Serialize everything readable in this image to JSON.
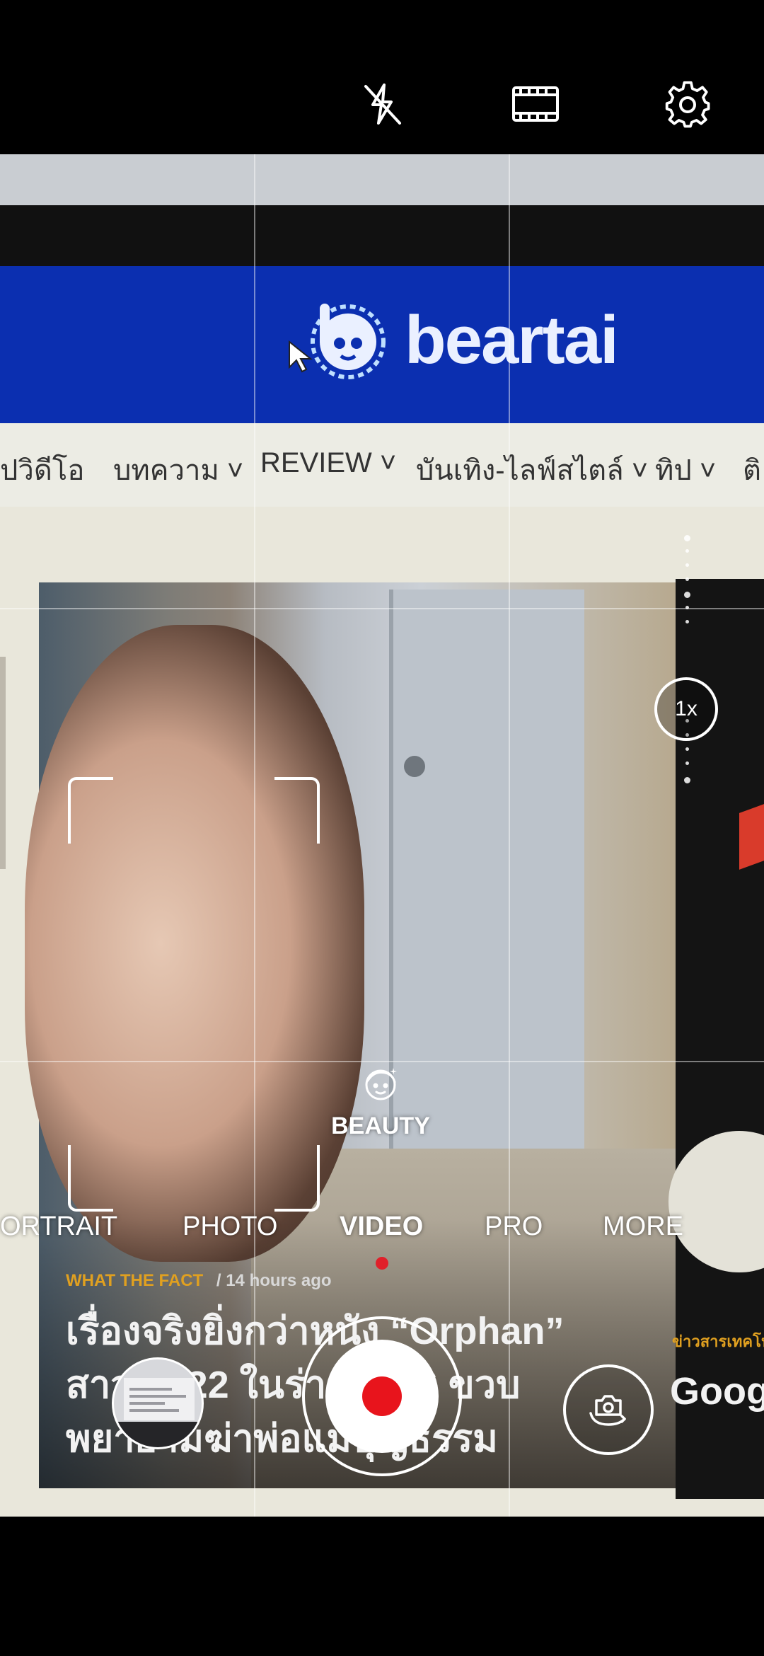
{
  "top_bar": {
    "flash_icon": "flash-off-icon",
    "ratio_icon": "aspect-ratio-icon",
    "settings_icon": "gear-icon"
  },
  "viewfinder_scene": {
    "site_logo": "beartai",
    "nav_items": [
      "ปวิดีโอ",
      "บทความ ˅",
      "REVIEW ˅",
      "บันเทิง-ไลฟ์สไตล์ ˅",
      "ทิป ˅",
      "ติ"
    ],
    "article": {
      "category": "WHAT THE FACT",
      "time": "/ 14 hours ago",
      "title": "เรื่องจริงยิ่งกว่าหนัง “Orphan” สาววัย 22 ในร่างเด็ก 6 ขวบ พยายามฆ่าพ่อแม่บุญธรรม"
    },
    "side_article": {
      "category": "ข่าวสารเทคโนโลยี",
      "title": "Googl ใช้งาน"
    }
  },
  "zoom": {
    "label": "1x"
  },
  "beauty": {
    "label": "BEAUTY",
    "icon": "beauty-face-icon"
  },
  "modes": {
    "items": [
      "ORTRAIT",
      "PHOTO",
      "VIDEO",
      "PRO",
      "MORE"
    ],
    "active": "VIDEO"
  },
  "controls": {
    "gallery_icon": "gallery-thumbnail",
    "record_icon": "record-icon",
    "switch_icon": "switch-camera-icon"
  },
  "colors": {
    "record": "#e8141c",
    "site_blue": "#0b2fb0",
    "meta_orange": "#e0a020"
  }
}
